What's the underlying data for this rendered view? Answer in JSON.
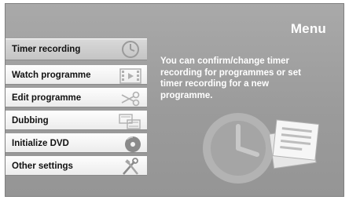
{
  "header": {
    "title": "Menu"
  },
  "menu": {
    "items": [
      {
        "label": "Timer recording",
        "icon": "clock-icon",
        "selected": true
      },
      {
        "label": "Watch programme",
        "icon": "film-icon",
        "selected": false
      },
      {
        "label": "Edit programme",
        "icon": "scissors-icon",
        "selected": false
      },
      {
        "label": "Dubbing",
        "icon": "dubbing-icon",
        "selected": false
      },
      {
        "label": "Initialize DVD",
        "icon": "disc-icon",
        "selected": false
      },
      {
        "label": "Other settings",
        "icon": "tools-icon",
        "selected": false
      }
    ]
  },
  "description": {
    "text": "You can confirm/change timer recording for programmes or set timer recording for a new programme."
  },
  "illustration": {
    "icon": "clock-and-documents-icon"
  },
  "colors": {
    "background": "#a0a0a0",
    "item_background": "#f4f4f4",
    "selected_background": "#cccccc",
    "text_light": "#ffffff",
    "text_dark": "#111111"
  }
}
